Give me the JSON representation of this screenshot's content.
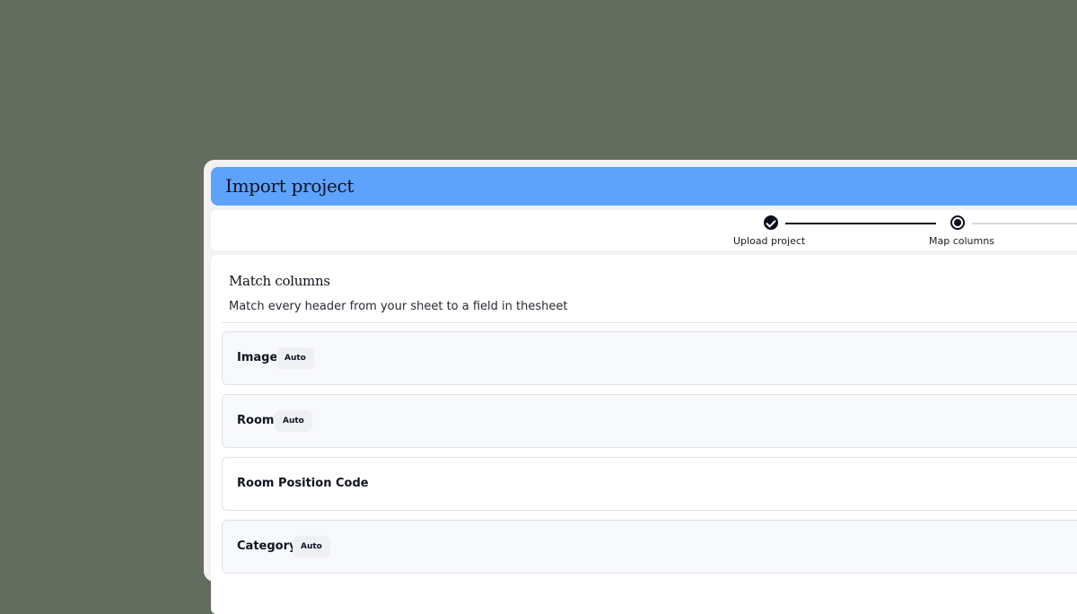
{
  "window": {
    "title": "Import project"
  },
  "stepper": {
    "steps": [
      {
        "label": "Upload project",
        "status": "complete"
      },
      {
        "label": "Map columns",
        "status": "current"
      }
    ]
  },
  "mapping": {
    "title": "Match columns",
    "subtitle": "Match every header from your sheet to a field in thesheet",
    "fields": [
      {
        "name": "Image",
        "badge": "Auto"
      },
      {
        "name": "Room",
        "badge": "Auto"
      },
      {
        "name": "Room Position Code",
        "badge": ""
      },
      {
        "name": "Category",
        "badge": "Auto"
      }
    ]
  },
  "colors": {
    "background": "#636d5f",
    "titlebar": "#5ea3fb",
    "accent_dark": "#0c0f1a"
  },
  "icons": {
    "step_complete": "check-circle-icon",
    "step_current": "radio-dot-icon"
  }
}
